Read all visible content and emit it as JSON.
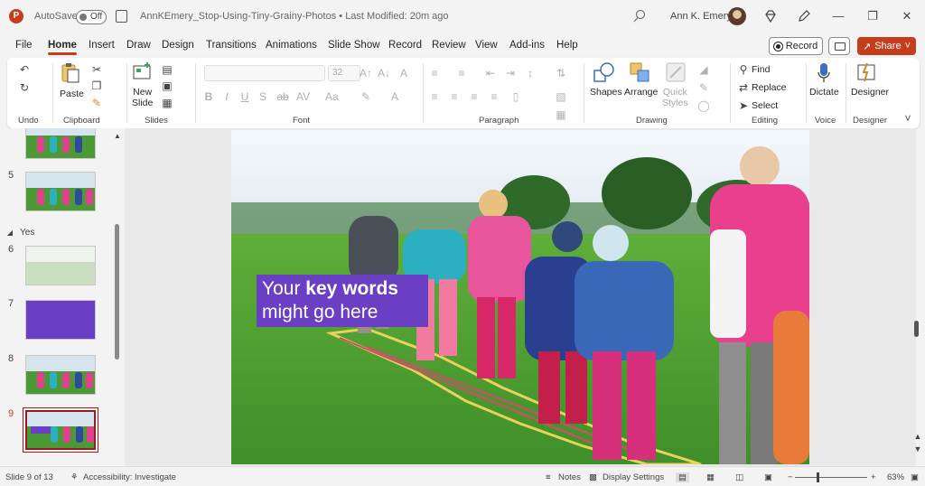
{
  "titlebar": {
    "app_logo": "P",
    "autosave_label": "AutoSave",
    "autosave_state": "Off",
    "document_title": "AnnKEmery_Stop-Using-Tiny-Grainy-Photos • Last Modified: 20m ago",
    "user_name": "Ann K. Emery"
  },
  "menu": {
    "items": [
      "File",
      "Home",
      "Insert",
      "Draw",
      "Design",
      "Transitions",
      "Animations",
      "Slide Show",
      "Record",
      "Review",
      "View",
      "Add-ins",
      "Help"
    ],
    "active": "Home",
    "record_label": "Record",
    "share_label": "Share"
  },
  "ribbon": {
    "groups": {
      "undo": "Undo",
      "clipboard": "Clipboard",
      "slides": "Slides",
      "font": "Font",
      "paragraph": "Paragraph",
      "drawing": "Drawing",
      "editing": "Editing",
      "voice": "Voice",
      "designer": "Designer"
    },
    "paste_label": "Paste",
    "new_slide_label": "New\nSlide",
    "font_size": "32",
    "shapes_label": "Shapes",
    "arrange_label": "Arrange",
    "quick_styles_label": "Quick\nStyles",
    "find_label": "Find",
    "replace_label": "Replace",
    "select_label": "Select",
    "dictate_label": "Dictate",
    "designer_label": "Designer"
  },
  "slides_panel": {
    "section_label": "Yes",
    "numbers": [
      "5",
      "6",
      "7",
      "8",
      "9"
    ],
    "selected": "9"
  },
  "slide": {
    "callout_pre": "Your ",
    "callout_bold": "key words",
    "callout_line2": "might go here"
  },
  "status": {
    "slide_count": "Slide 9 of 13",
    "accessibility": "Accessibility: Investigate",
    "notes": "Notes",
    "display_settings": "Display Settings",
    "zoom": "63%"
  },
  "colors": {
    "accent": "#c43e1c",
    "callout_bg": "#6a3fc4"
  }
}
